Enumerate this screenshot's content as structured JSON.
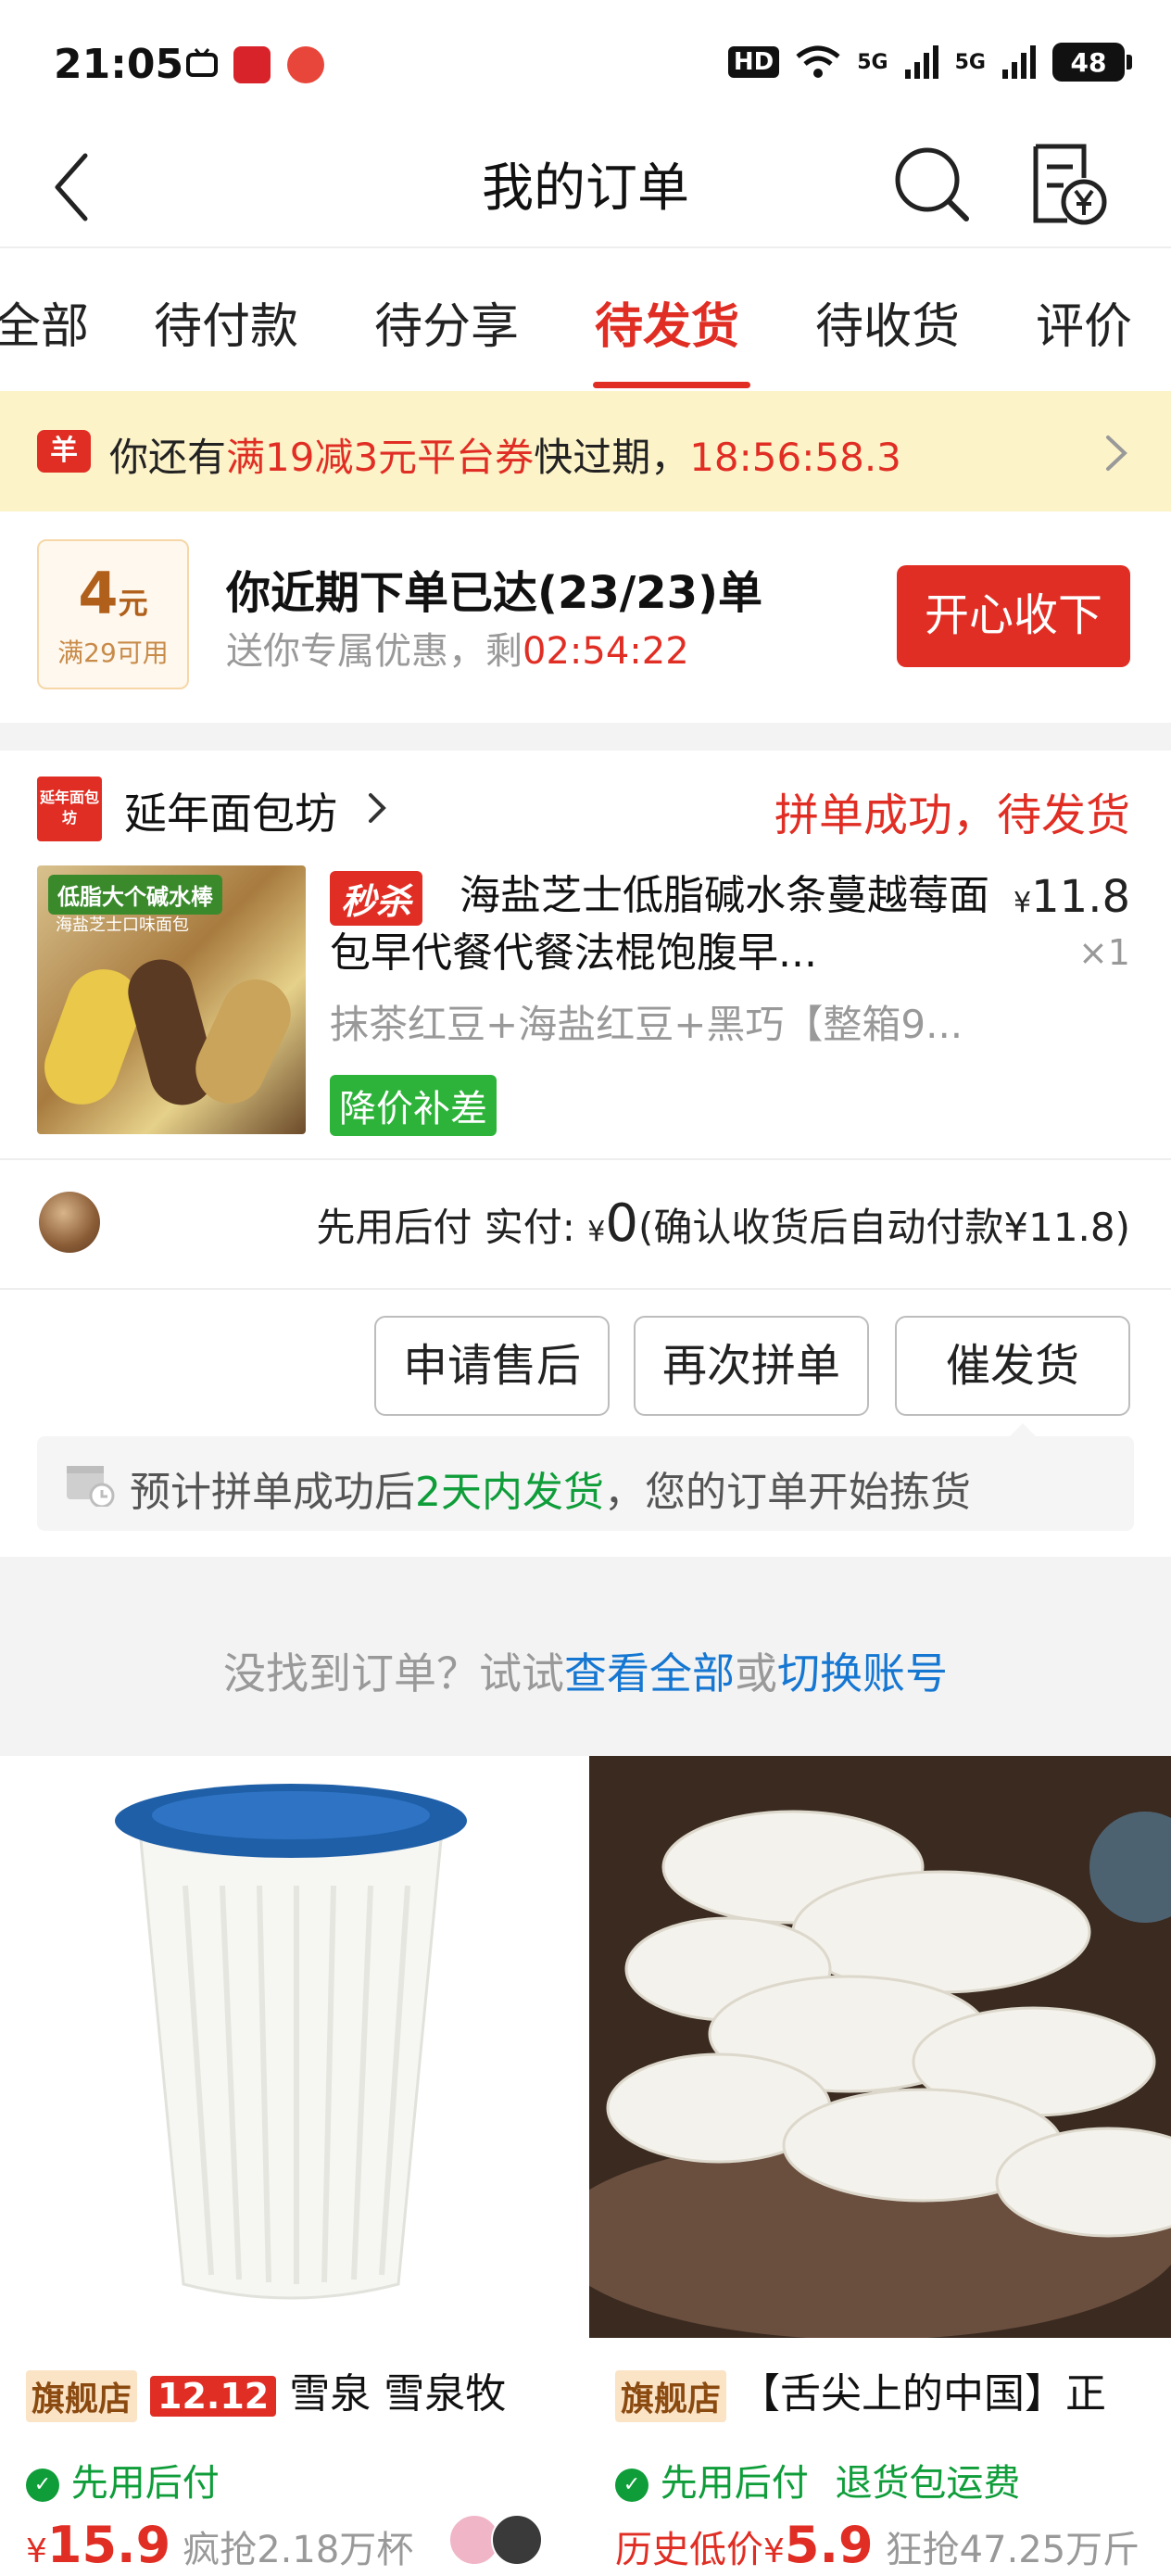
{
  "status_bar": {
    "time": "21:05",
    "hd": "HD",
    "net1": "5G",
    "net2": "5G",
    "battery": "48"
  },
  "header": {
    "title": "我的订单"
  },
  "tabs": [
    {
      "label": "全部"
    },
    {
      "label": "待付款"
    },
    {
      "label": "待分享"
    },
    {
      "label": "待发货"
    },
    {
      "label": "待收货"
    },
    {
      "label": "评价"
    }
  ],
  "coupon_banner": {
    "badge": "羊",
    "prefix": "你还有",
    "highlight": "满19减3元平台券",
    "suffix": "快过期，",
    "countdown": "18:56:58.3"
  },
  "coupon_card": {
    "amount": "4",
    "unit": "元",
    "condition": "满29可用",
    "title": "你近期下单已达(23/23)单",
    "sub_prefix": "送你专属优惠，剩",
    "sub_countdown": "02:54:22",
    "button": "开心收下"
  },
  "order": {
    "shop_logo": "延年面包坊",
    "shop_name": "延年面包坊",
    "status": "拼单成功，待发货",
    "image_label": "低脂大个碱水棒",
    "image_sub": "海盐芝士口味面包",
    "flash_tag": "秒杀",
    "title": "海盐芝士低脂碱水条蔓越莓面包早代餐代餐法棍饱腹早...",
    "price_symbol": "¥",
    "price": "11.8",
    "qty": "×1",
    "spec": "抹茶红豆+海盐红豆+黑巧【整箱9...",
    "price_tag": "降价补差",
    "pay_prefix": "先用后付 实付: ",
    "pay_yen": "¥",
    "pay_amount": "0",
    "pay_suffix": "(确认收货后自动付款¥11.8)",
    "buttons": {
      "after_sale": "申请售后",
      "regroup": "再次拼单",
      "urge": "催发货"
    },
    "notice_prefix": "预计拼单成功后",
    "notice_highlight": "2天内发货",
    "notice_suffix": "，您的订单开始拣货"
  },
  "not_found": {
    "prefix": "没找到订单？试试",
    "link1": "查看全部",
    "mid": "或",
    "link2": "切换账号"
  },
  "recommend": [
    {
      "flag": "旗舰店",
      "promo": "12.12",
      "title": "雪泉 雪泉牧",
      "bnpl_icon": "✓",
      "bnpl": "先用后付",
      "yen": "¥",
      "price": "15.9",
      "sales": "疯抢2.18万杯"
    },
    {
      "flag": "旗舰店",
      "title": "【舌尖上的中国】正",
      "bnpl_icon": "✓",
      "bnpl": "先用后付",
      "extra": "退货包运费",
      "hist": "历史低价",
      "yen": "¥",
      "price": "5.9",
      "sales": "狂抢47.25万斤"
    }
  ],
  "colors": {
    "accent": "#e02e24",
    "green": "#0f9d3a",
    "link": "#1677d2",
    "banner_bg": "#fdf3c9"
  }
}
